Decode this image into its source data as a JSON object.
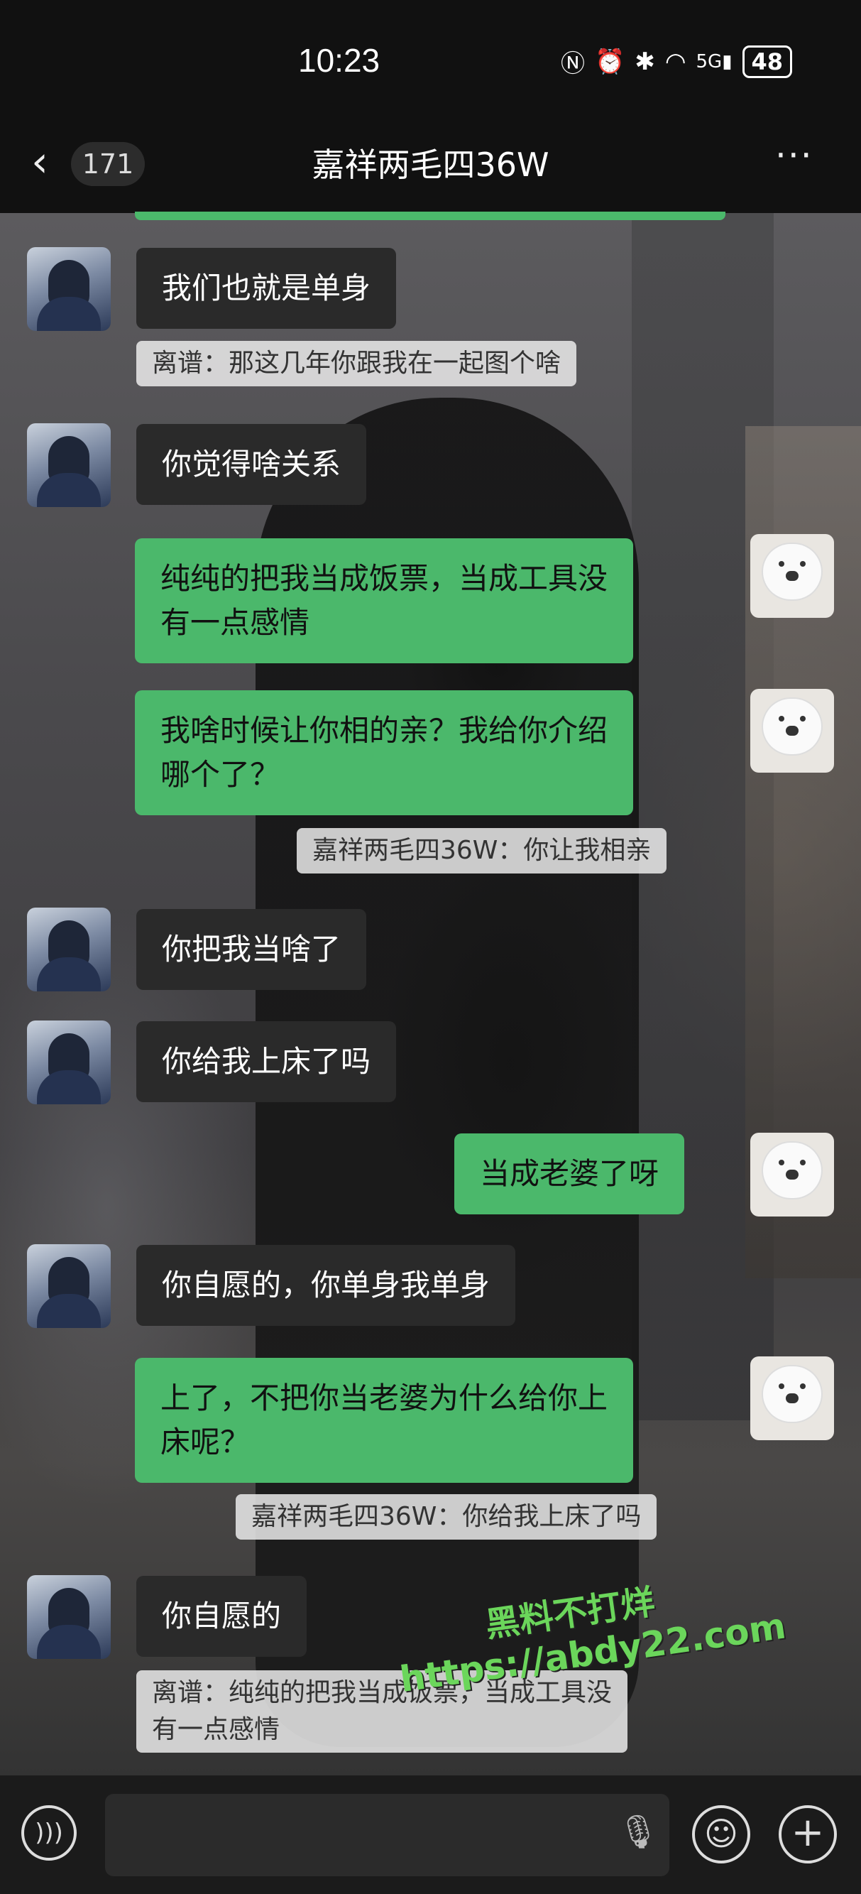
{
  "status_bar": {
    "time": "10:23",
    "icons": [
      "nfc-icon",
      "alarm-icon",
      "bluetooth-icon",
      "wifi-icon",
      "signal-5g-icon"
    ],
    "signal_label": "5G",
    "battery": "48"
  },
  "header": {
    "unread_count": "171",
    "title": "嘉祥两毛四36W"
  },
  "messages": [
    {
      "side": "left",
      "text": "我们也就是单身"
    },
    {
      "side": "quote-left",
      "text": "离谱：那这几年你跟我在一起图个啥"
    },
    {
      "side": "left",
      "text": "你觉得啥关系"
    },
    {
      "side": "right",
      "text": "纯纯的把我当成饭票，当成工具没\n有一点感情"
    },
    {
      "side": "right",
      "text": "我啥时候让你相的亲？我给你介绍\n哪个了？"
    },
    {
      "side": "quote-right",
      "text": "嘉祥两毛四36W：你让我相亲"
    },
    {
      "side": "left",
      "text": "你把我当啥了"
    },
    {
      "side": "left",
      "text": "你给我上床了吗"
    },
    {
      "side": "right",
      "text": "当成老婆了呀"
    },
    {
      "side": "left",
      "text": "你自愿的，你单身我单身"
    },
    {
      "side": "right",
      "text": "上了，不把你当老婆为什么给你上\n床呢？"
    },
    {
      "side": "quote-right",
      "text": "嘉祥两毛四36W：你给我上床了吗"
    },
    {
      "side": "left",
      "text": "你自愿的"
    },
    {
      "side": "quote-left",
      "text": "离谱：纯纯的把我当成饭票，当成工具没\n有一点感情"
    }
  ],
  "watermark": {
    "line1": "黑料不打烊",
    "line2": "https://abdy22.com"
  },
  "input_bar": {
    "placeholder": ""
  }
}
